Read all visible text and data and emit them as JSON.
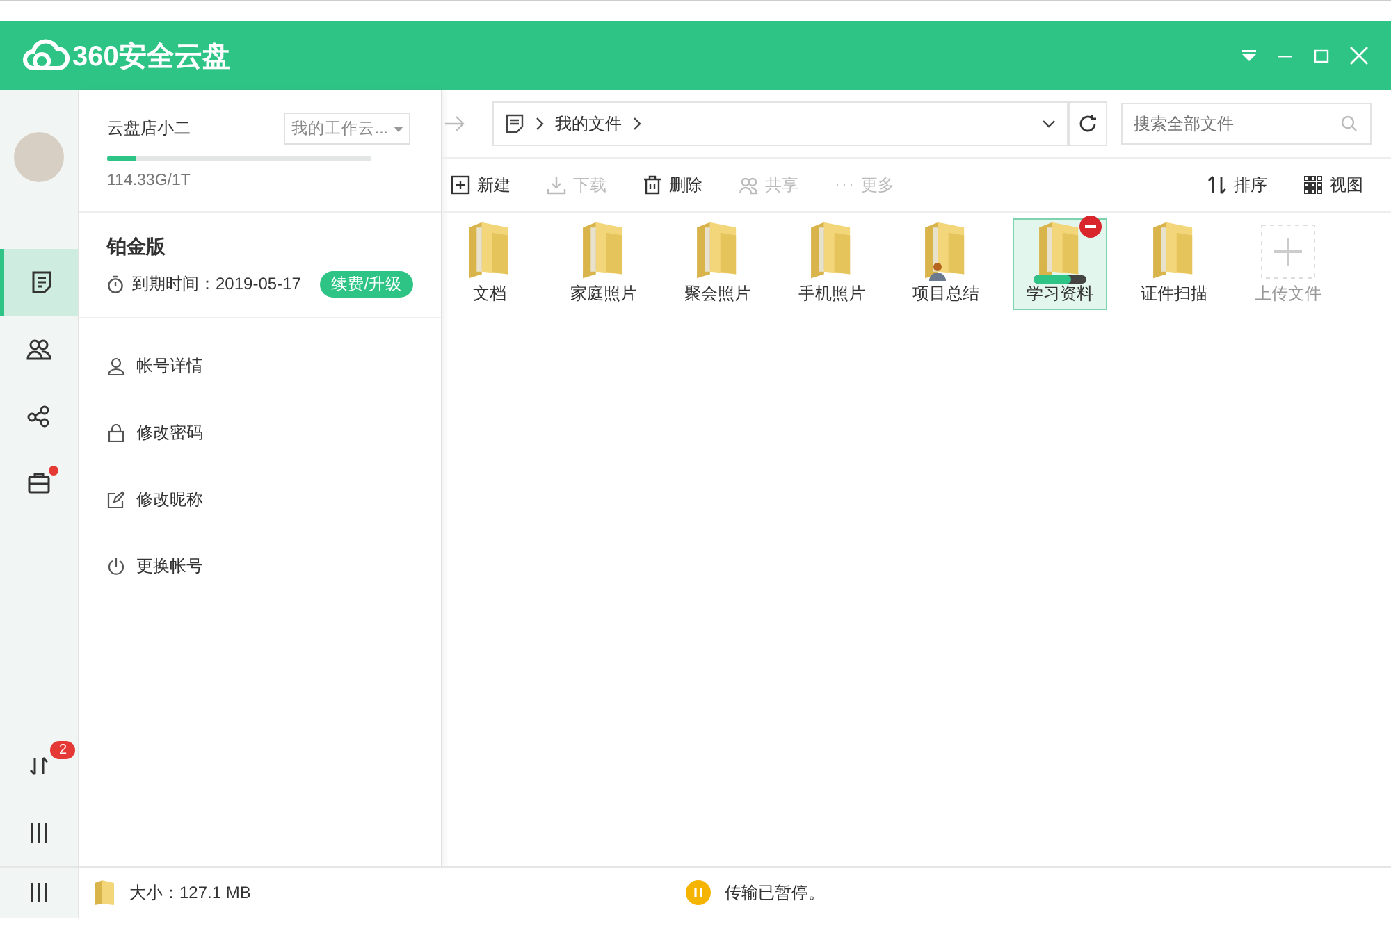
{
  "window": {
    "logo": "360安全云盘"
  },
  "rail": {
    "items": [
      {
        "kind": "files",
        "selected": true,
        "dot": false
      },
      {
        "kind": "group",
        "selected": false,
        "dot": false
      },
      {
        "kind": "share",
        "selected": false,
        "dot": false
      },
      {
        "kind": "toolbox",
        "selected": false,
        "dot": true
      }
    ],
    "transfer_badge": "2"
  },
  "account": {
    "name": "云盘店小二",
    "workspace": "我的工作云...",
    "storage": {
      "level": 0.11,
      "text": "114.33G/1T"
    },
    "plan": "铂金版",
    "expiry": "到期时间：2019-05-17",
    "upgrade": "续费/升级",
    "menu": [
      {
        "kind": "user",
        "label": "帐号详情"
      },
      {
        "kind": "lock",
        "label": "修改密码"
      },
      {
        "kind": "edit",
        "label": "修改昵称"
      },
      {
        "kind": "power",
        "label": "更换帐号"
      }
    ]
  },
  "path": [
    "我的文件"
  ],
  "search": {
    "placeholder": "搜索全部文件"
  },
  "toolbar": [
    {
      "kind": "new",
      "label": "新建",
      "disabled": false
    },
    {
      "kind": "download",
      "label": "下载",
      "disabled": true
    },
    {
      "kind": "delete",
      "label": "删除",
      "disabled": false
    },
    {
      "kind": "share",
      "label": "共享",
      "disabled": true
    },
    {
      "kind": "more",
      "label": "更多",
      "disabled": true
    }
  ],
  "toolbar_right": [
    {
      "kind": "sort",
      "label": "排序"
    },
    {
      "kind": "view",
      "label": "视图"
    }
  ],
  "files": [
    {
      "kind": "folder",
      "name": "文档",
      "selected": false,
      "shared": false
    },
    {
      "kind": "folder",
      "name": "家庭照片",
      "selected": false,
      "shared": false
    },
    {
      "kind": "folder",
      "name": "聚会照片",
      "selected": false,
      "shared": false
    },
    {
      "kind": "folder",
      "name": "手机照片",
      "selected": false,
      "shared": false
    },
    {
      "kind": "folder",
      "name": "项目总结",
      "selected": false,
      "shared": true
    },
    {
      "kind": "folder",
      "name": "学习资料",
      "selected": true,
      "shared": false,
      "level": 0.7
    },
    {
      "kind": "folder",
      "name": "证件扫描",
      "selected": false,
      "shared": false
    },
    {
      "kind": "upload",
      "name": "上传文件",
      "selected": false
    }
  ],
  "status": {
    "size": "大小：127.1 MB",
    "transfer": "传输已暂停。"
  }
}
